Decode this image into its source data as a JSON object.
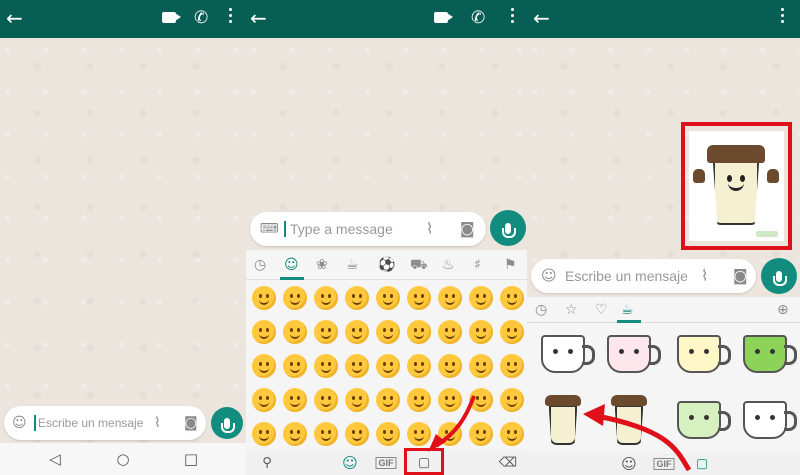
{
  "panel1": {
    "input": {
      "placeholder": "Escribe un mensaje"
    },
    "icons": [
      "back-arrow-icon",
      "video-call-icon",
      "phone-icon",
      "more-options-icon",
      "emoji-icon",
      "attach-icon",
      "camera-icon",
      "mic-icon"
    ],
    "nav": [
      "back-nav-icon",
      "home-nav-icon",
      "recents-nav-icon"
    ]
  },
  "panel2": {
    "input": {
      "placeholder": "Type a message"
    },
    "emoji_categories": [
      "recent-icon",
      "smileys-icon",
      "animals-icon",
      "food-icon",
      "activity-icon",
      "travel-icon",
      "objects-icon",
      "symbols-icon",
      "flags-icon"
    ],
    "bottom_tabs": {
      "gif_label": "GIF"
    }
  },
  "panel3": {
    "input": {
      "placeholder": "Escribe un mensaje"
    },
    "sticker_tabs": [
      "recent-icon",
      "star-icon",
      "heart-icon",
      "sticker-pack-icon",
      "add-icon"
    ],
    "bottom_tabs": {
      "gif_label": "GIF"
    }
  },
  "colors": {
    "header": "#075e54",
    "accent": "#128c7e",
    "highlight": "#e0101a",
    "chat_bg": "#ece5dd"
  }
}
